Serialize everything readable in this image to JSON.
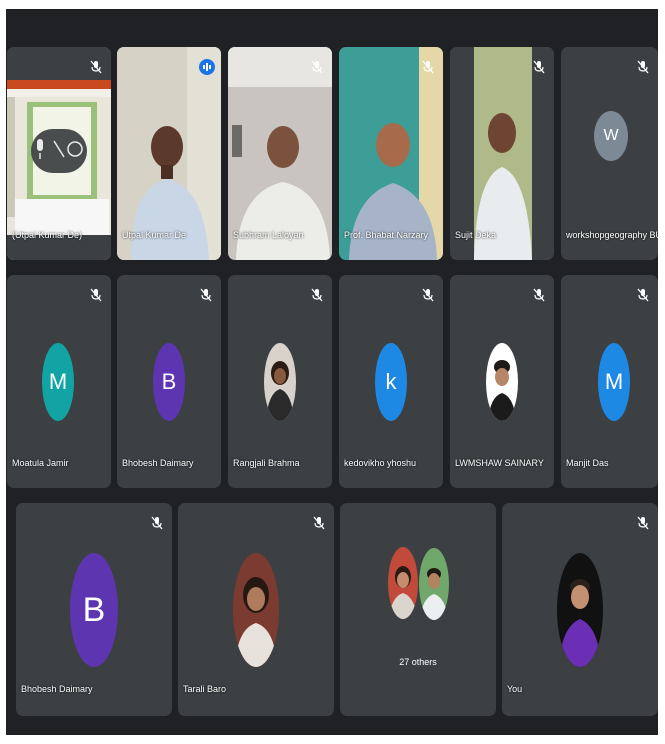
{
  "participants": {
    "row1": [
      {
        "name": "(Utpal Kumar De)",
        "kind": "presentation"
      },
      {
        "name": "Utpal Kumar De",
        "kind": "video",
        "speaking": true
      },
      {
        "name": "Subhram Laloyan",
        "kind": "video"
      },
      {
        "name": "Prof. Bhabat Narzary",
        "kind": "video"
      },
      {
        "name": "Sujit Deka",
        "kind": "video"
      },
      {
        "name": "workshopgeography BU",
        "kind": "avatar",
        "initial": "W",
        "color": "#7d8a96"
      }
    ],
    "row2": [
      {
        "name": "Moatula Jamir",
        "kind": "avatar",
        "initial": "M",
        "color": "#12a4a4"
      },
      {
        "name": "Bhobesh Daimary",
        "kind": "avatar",
        "initial": "B",
        "color": "#5e35b1"
      },
      {
        "name": "Rangjali Brahma",
        "kind": "photo"
      },
      {
        "name": "kedovikho yhoshu",
        "kind": "avatar",
        "initial": "k",
        "color": "#1e88e5"
      },
      {
        "name": "LWMSHAW SAINARY",
        "kind": "photo"
      },
      {
        "name": "Manjit Das",
        "kind": "avatar",
        "initial": "M",
        "color": "#1e88e5"
      }
    ],
    "row3": [
      {
        "name": "Bhobesh Daimary",
        "kind": "avatar",
        "initial": "B",
        "color": "#5e35b1"
      },
      {
        "name": "Tarali Baro",
        "kind": "photo"
      },
      {
        "name": "27 others",
        "kind": "others"
      },
      {
        "name": "You",
        "kind": "photo"
      }
    ]
  }
}
